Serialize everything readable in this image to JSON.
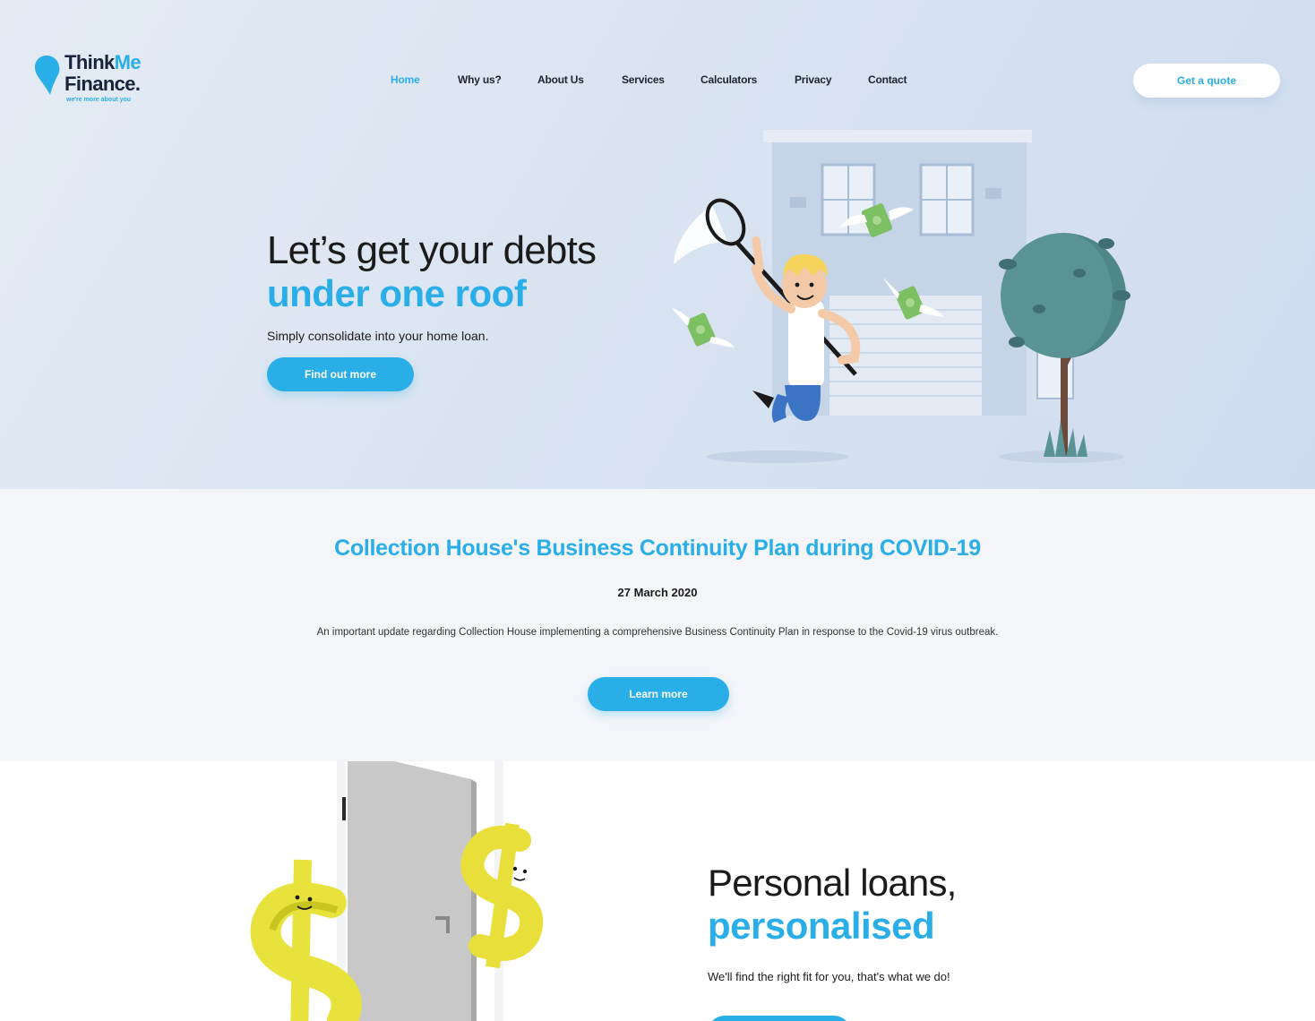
{
  "brand": {
    "name_line1_a": "Think",
    "name_line1_b": "Me",
    "name_line2": "Finance.",
    "tagline": "we're more about you",
    "accent_color": "#29aee8"
  },
  "nav": {
    "items": [
      {
        "label": "Home",
        "active": true
      },
      {
        "label": "Why us?"
      },
      {
        "label": "About Us"
      },
      {
        "label": "Services"
      },
      {
        "label": "Calculators"
      },
      {
        "label": "Privacy"
      },
      {
        "label": "Contact"
      }
    ],
    "cta": "Get a quote"
  },
  "hero": {
    "title": "Let’s get your debts",
    "highlight": "under one roof",
    "subtitle": "Simply consolidate into your home loan.",
    "button": "Find out more"
  },
  "news": {
    "title": "Collection House's Business Continuity Plan during COVID-19",
    "date": "27 March 2020",
    "body": "An important update regarding Collection House implementing a comprehensive Business Continuity Plan in response to the Covid-19 virus outbreak.",
    "button": "Learn more"
  },
  "loans": {
    "title": "Personal loans,",
    "highlight": "personalised",
    "subtitle": "We'll find the right fit for you, that's what we do!"
  },
  "icons": {
    "logo": "speech-drop-icon",
    "hero_illustration": "house-butterfly-net-money-illustration",
    "loans_illustration": "door-dollar-signs-illustration"
  }
}
